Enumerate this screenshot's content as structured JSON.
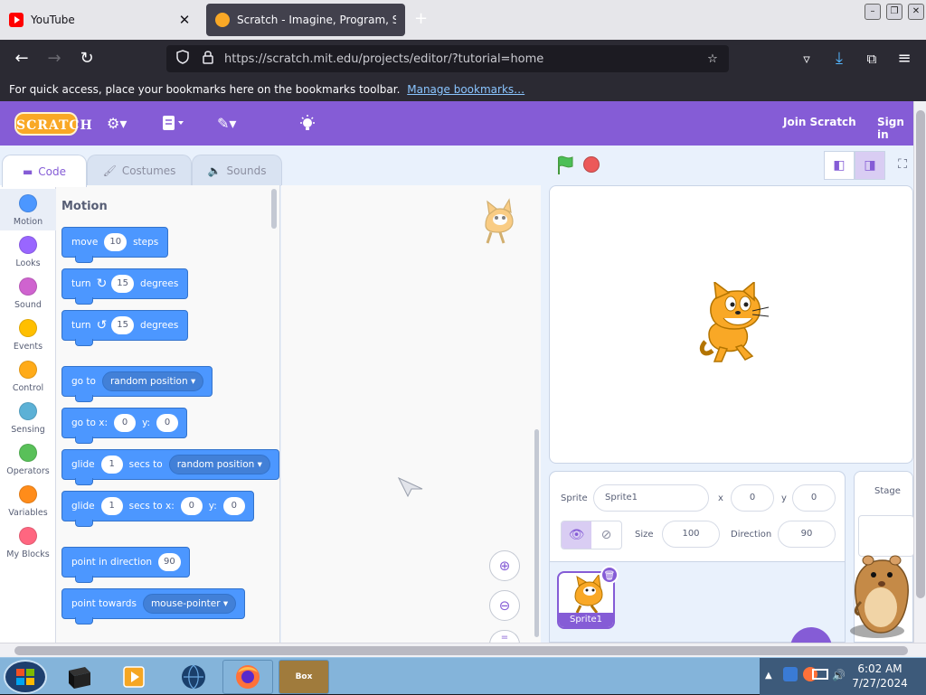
{
  "browser": {
    "tabs": [
      {
        "title": "YouTube",
        "active": false
      },
      {
        "title": "Scratch - Imagine, Program, Sh",
        "active": true
      }
    ],
    "url": "https://scratch.mit.edu/projects/editor/?tutorial=home",
    "bookmarks_bar": {
      "message": "For quick access, place your bookmarks here on the bookmarks toolbar.",
      "link": "Manage bookmarks…"
    }
  },
  "scratch_menu": {
    "logo_text": "SCRATCH",
    "join": "Join Scratch",
    "sign_in": "Sign in"
  },
  "editor_tabs": [
    {
      "label": "Code"
    },
    {
      "label": "Costumes"
    },
    {
      "label": "Sounds"
    }
  ],
  "categories": [
    {
      "label": "Motion",
      "color": "#4c97ff"
    },
    {
      "label": "Looks",
      "color": "#9966ff"
    },
    {
      "label": "Sound",
      "color": "#cf63cf"
    },
    {
      "label": "Events",
      "color": "#ffbf00"
    },
    {
      "label": "Control",
      "color": "#ffab19"
    },
    {
      "label": "Sensing",
      "color": "#5cb1d6"
    },
    {
      "label": "Operators",
      "color": "#59c059"
    },
    {
      "label": "Variables",
      "color": "#ff8c1a"
    },
    {
      "label": "My Blocks",
      "color": "#ff6680"
    }
  ],
  "flyout": {
    "title": "Motion",
    "blocks": {
      "move": {
        "t1": "move",
        "v1": "10",
        "t2": "steps"
      },
      "turn_right": {
        "t1": "turn",
        "v1": "15",
        "t2": "degrees"
      },
      "turn_left": {
        "t1": "turn",
        "v1": "15",
        "t2": "degrees"
      },
      "go_to": {
        "t1": "go to",
        "d1": "random position"
      },
      "go_to_xy": {
        "t1": "go to x:",
        "v1": "0",
        "t2": "y:",
        "v2": "0"
      },
      "glide_to": {
        "t1": "glide",
        "v1": "1",
        "t2": "secs to",
        "d1": "random position"
      },
      "glide_xy": {
        "t1": "glide",
        "v1": "1",
        "t2": "secs to x:",
        "v2": "0",
        "t3": "y:",
        "v3": "0"
      },
      "point_dir": {
        "t1": "point in direction",
        "v1": "90"
      },
      "point_towards": {
        "t1": "point towards",
        "d1": "mouse-pointer"
      }
    }
  },
  "sprite_info": {
    "sprite_label": "Sprite",
    "sprite_name": "Sprite1",
    "x_label": "x",
    "x": "0",
    "y_label": "y",
    "y": "0",
    "size_label": "Size",
    "size": "100",
    "direction_label": "Direction",
    "direction": "90"
  },
  "sprite_list": [
    {
      "name": "Sprite1"
    }
  ],
  "stage_pane": {
    "title": "Stage"
  },
  "taskbar": {
    "time": "6:02 AM",
    "date": "7/27/2024",
    "box_label": "Box"
  },
  "colors": {
    "scratch_purple": "#855cd6",
    "motion_blue": "#4c97ff",
    "cat_orange": "#f9a826"
  }
}
